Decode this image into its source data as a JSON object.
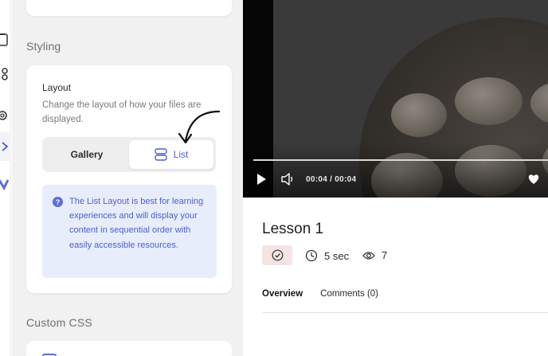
{
  "sections": {
    "styling_title": "Styling",
    "custom_css_title": "Custom CSS"
  },
  "layout_card": {
    "title": "Layout",
    "description": "Change the layout of how your files are displayed.",
    "options": [
      "Gallery",
      "List"
    ],
    "selected": "List",
    "info": "The List Layout is best for learning experiences and will display your content in sequential order with easily accessible resources."
  },
  "video": {
    "time": "00:04 / 00:04",
    "progress": 1.0
  },
  "lesson": {
    "title": "Lesson 1",
    "duration": "5 sec",
    "views": "7",
    "tabs": [
      "Overview",
      "Comments (0)"
    ],
    "active_tab": "Overview"
  },
  "colors": {
    "accent": "#4a5fd0",
    "info_bg": "#e8edfb",
    "badge_bg": "#f6e3e3"
  }
}
